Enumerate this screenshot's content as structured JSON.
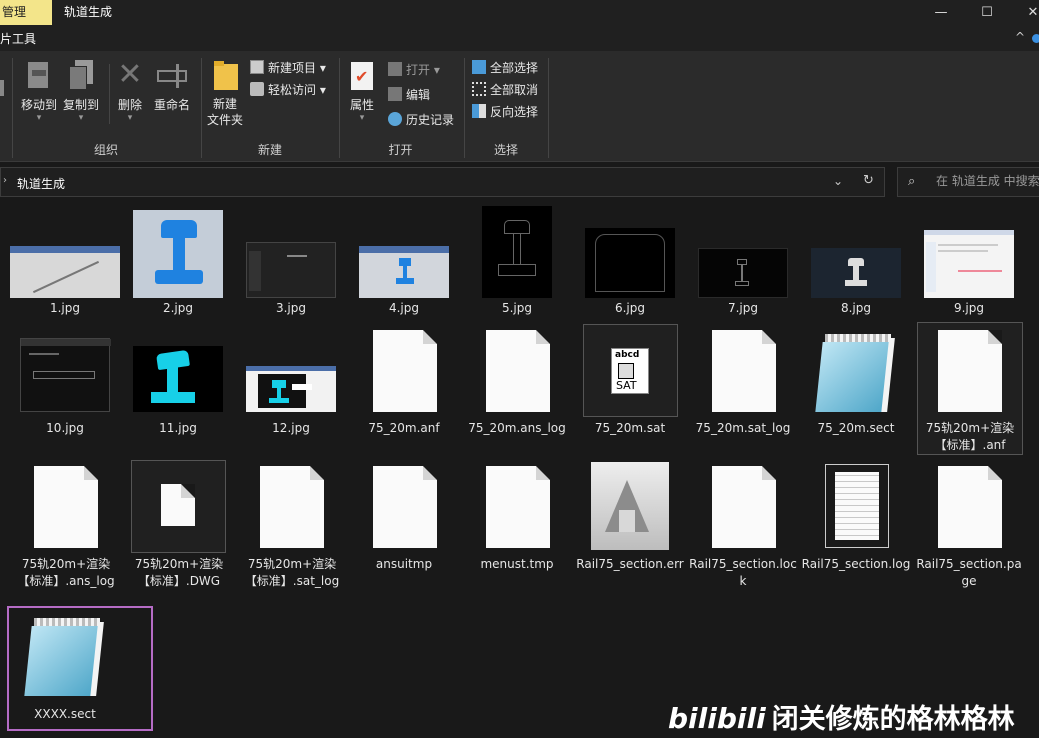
{
  "titlebar": {
    "manage_tab": "管理",
    "title": "轨道生成",
    "min": "—",
    "max": "☐",
    "close": "✕"
  },
  "context": {
    "tool": "片工具",
    "collapse": "^"
  },
  "ribbon": {
    "organize": {
      "label": "组织",
      "move_to": "移动到",
      "copy_to": "复制到",
      "delete": "删除",
      "rename": "重命名"
    },
    "new": {
      "label": "新建",
      "new_folder": "新建\n文件夹",
      "new_item": "新建项目 ▾",
      "easy_access": "轻松访问 ▾"
    },
    "open": {
      "label": "打开",
      "properties": "属性",
      "open": "打开 ▾",
      "edit": "编辑",
      "history": "历史记录"
    },
    "select": {
      "label": "选择",
      "select_all": "全部选择",
      "select_none": "全部取消",
      "invert": "反向选择"
    }
  },
  "address": {
    "arrow": "›",
    "path": "轨道生成",
    "dropdown": "⌄",
    "refresh": "↻"
  },
  "search": {
    "icon": "⌕",
    "placeholder": "在 轨道生成 中搜索"
  },
  "files": [
    {
      "name": "1.jpg",
      "type": "jpg"
    },
    {
      "name": "2.jpg",
      "type": "jpg"
    },
    {
      "name": "3.jpg",
      "type": "jpg"
    },
    {
      "name": "4.jpg",
      "type": "jpg"
    },
    {
      "name": "5.jpg",
      "type": "jpg"
    },
    {
      "name": "6.jpg",
      "type": "jpg"
    },
    {
      "name": "7.jpg",
      "type": "jpg"
    },
    {
      "name": "8.jpg",
      "type": "jpg"
    },
    {
      "name": "9.jpg",
      "type": "jpg"
    },
    {
      "name": "10.jpg",
      "type": "jpg"
    },
    {
      "name": "11.jpg",
      "type": "jpg"
    },
    {
      "name": "12.jpg",
      "type": "jpg"
    },
    {
      "name": "75_20m.anf",
      "type": "doc"
    },
    {
      "name": "75_20m.ans_log",
      "type": "doc"
    },
    {
      "name": "75_20m.sat",
      "type": "sat",
      "icon_text_top": "abcd",
      "icon_text_bottom": "SAT"
    },
    {
      "name": "75_20m.sat_log",
      "type": "doc"
    },
    {
      "name": "75_20m.sect",
      "type": "notepad"
    },
    {
      "name": "75轨20m+渲染【标准】.anf",
      "type": "doc"
    },
    {
      "name": "75轨20m+渲染【标准】.ans_log",
      "type": "doc"
    },
    {
      "name": "75轨20m+渲染【标准】.DWG",
      "type": "doc"
    },
    {
      "name": "75轨20m+渲染【标准】.sat_log",
      "type": "doc"
    },
    {
      "name": "ansuitmp",
      "type": "doc"
    },
    {
      "name": "menust.tmp",
      "type": "doc"
    },
    {
      "name": "Rail75_section.err",
      "type": "autodesk"
    },
    {
      "name": "Rail75_section.lock",
      "type": "doc"
    },
    {
      "name": "Rail75_section.log",
      "type": "lined"
    },
    {
      "name": "Rail75_section.page",
      "type": "doc"
    },
    {
      "name": "XXXX.sect",
      "type": "notepad"
    }
  ],
  "watermark": {
    "logo": "bilibili",
    "text": "闭关修炼的格林格林"
  }
}
